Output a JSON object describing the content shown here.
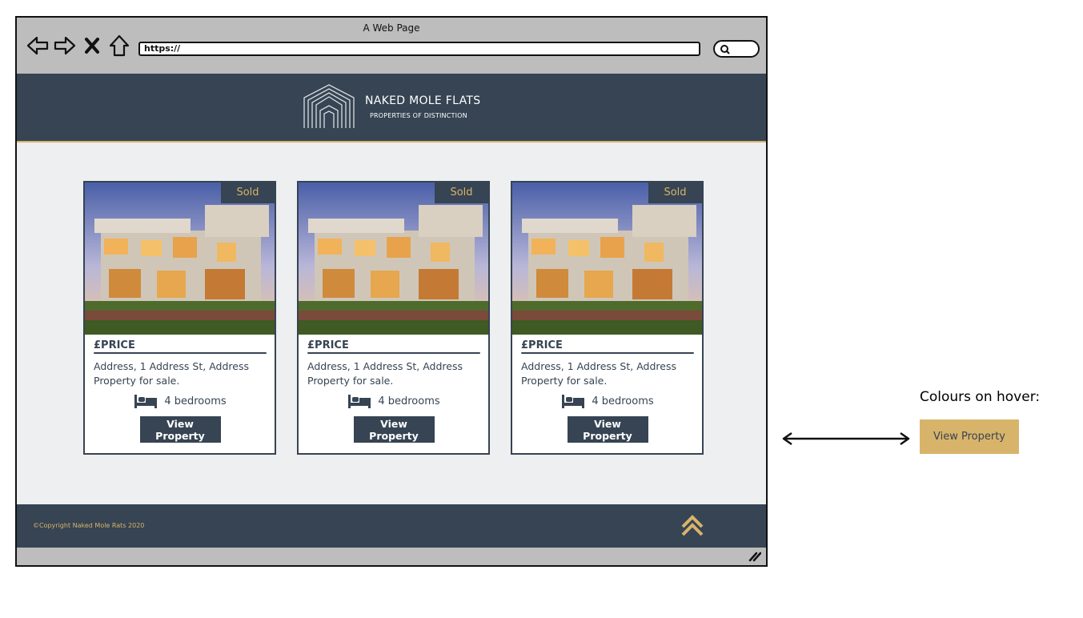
{
  "browser": {
    "title": "A Web Page",
    "url": "https://"
  },
  "header": {
    "brand_title": "NAKED MOLE FLATS",
    "brand_subtitle": "PROPERTIES OF DISTINCTION"
  },
  "cards": [
    {
      "badge": "Sold",
      "price": "£PRICE",
      "address": "Address, 1 Address St, Address Property for sale.",
      "bedrooms": "4 bedrooms",
      "button": "View Property"
    },
    {
      "badge": "Sold",
      "price": "£PRICE",
      "address": "Address, 1 Address St, Address Property for sale.",
      "bedrooms": "4 bedrooms",
      "button": "View Property"
    },
    {
      "badge": "Sold",
      "price": "£PRICE",
      "address": "Address, 1 Address St, Address Property for sale.",
      "bedrooms": "4 bedrooms",
      "button": "View Property"
    }
  ],
  "footer": {
    "copyright": "©Copyright Naked Mole Rats 2020"
  },
  "annotation": {
    "hover_label": "Colours on hover:",
    "hover_button": "View Property"
  },
  "colors": {
    "primary": "#364453",
    "accent": "#d8b36a",
    "background": "#edeff0"
  }
}
